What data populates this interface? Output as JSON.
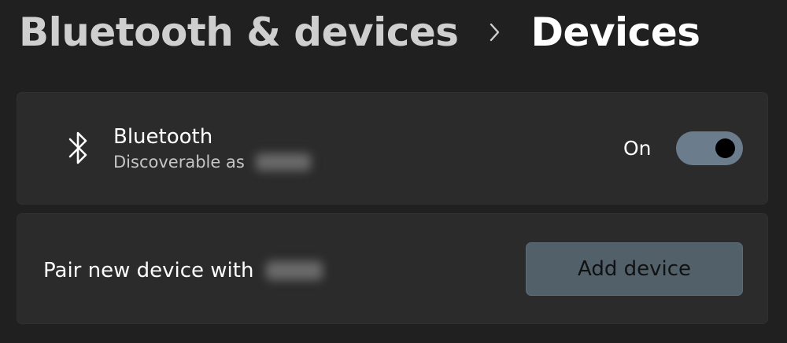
{
  "breadcrumb": {
    "parent": "Bluetooth & devices",
    "current": "Devices"
  },
  "bluetooth_card": {
    "icon": "bluetooth-icon",
    "title": "Bluetooth",
    "subtitle": "Discoverable as",
    "toggle_state_label": "On",
    "toggle_on": true
  },
  "pair_card": {
    "label": "Pair new device with",
    "button_label": "Add device"
  },
  "colors": {
    "background": "#202020",
    "card": "#2b2b2b",
    "toggle_track": "#6b7d8c",
    "button": "#52606a"
  }
}
